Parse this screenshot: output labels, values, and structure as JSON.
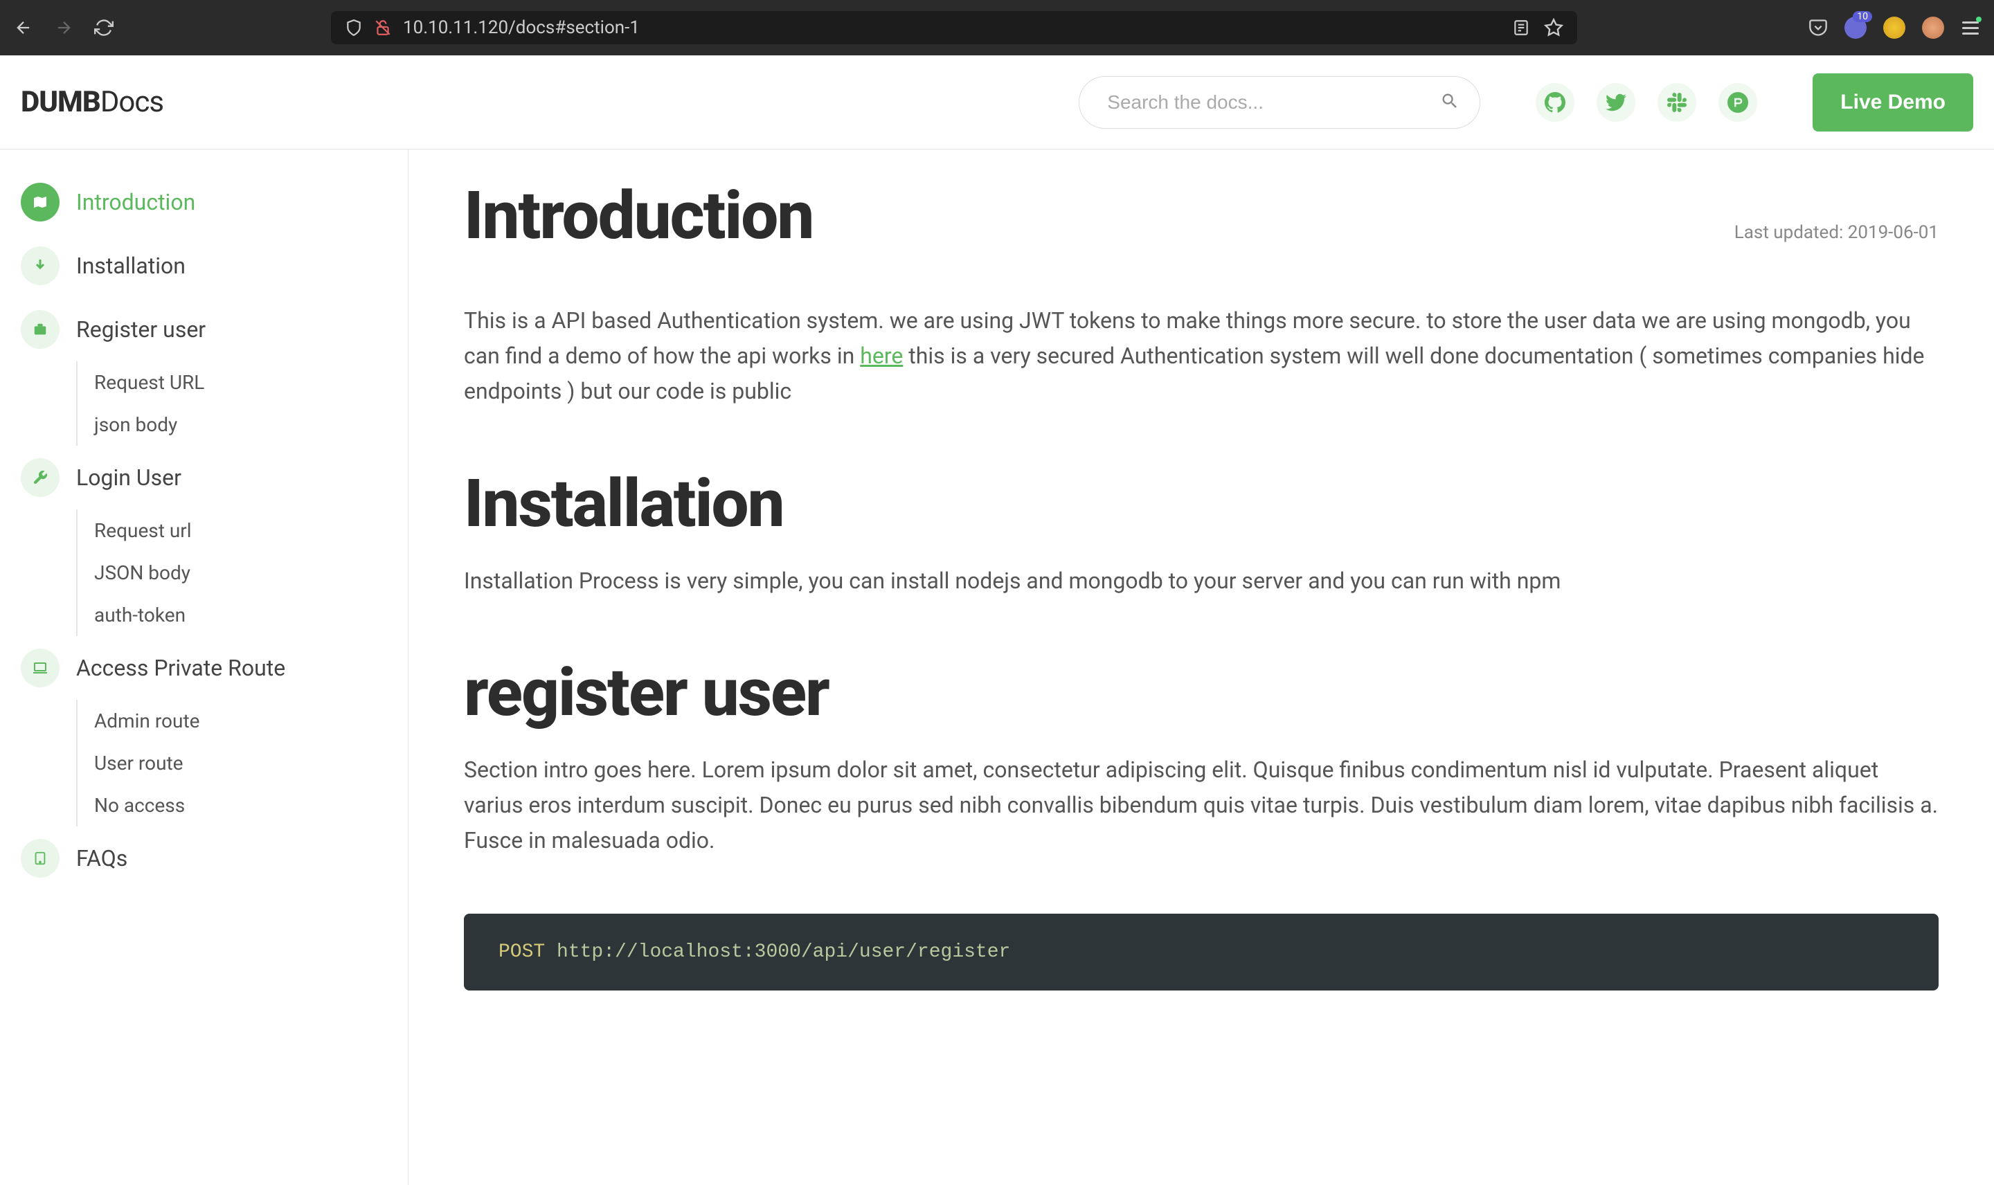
{
  "browser": {
    "url": "10.10.11.120/docs#section-1",
    "badge": "10"
  },
  "header": {
    "logo_bold": "DUMB",
    "logo_rest": "Docs",
    "search_placeholder": "Search the docs...",
    "live_demo": "Live Demo"
  },
  "sidebar": {
    "items": [
      {
        "label": "Introduction",
        "active": true,
        "icon": "map"
      },
      {
        "label": "Installation",
        "icon": "download"
      },
      {
        "label": "Register user",
        "icon": "briefcase",
        "children": [
          {
            "label": "Request URL"
          },
          {
            "label": "json body"
          }
        ]
      },
      {
        "label": "Login User",
        "icon": "tools",
        "children": [
          {
            "label": "Request url"
          },
          {
            "label": "JSON body"
          },
          {
            "label": "auth-token"
          }
        ]
      },
      {
        "label": "Access Private Route",
        "icon": "laptop",
        "children": [
          {
            "label": "Admin route"
          },
          {
            "label": "User route"
          },
          {
            "label": "No access"
          }
        ]
      },
      {
        "label": "FAQs",
        "icon": "tablet"
      }
    ]
  },
  "content": {
    "intro": {
      "title": "Introduction",
      "last_updated": "Last updated: 2019-06-01",
      "text_before": "This is a API based Authentication system. we are using JWT tokens to make things more secure. to store the user data we are using mongodb, you can find a demo of how the api works in ",
      "link": "here",
      "text_after": " this is a very secured Authentication system will well done documentation ( sometimes companies hide endpoints ) but our code is public"
    },
    "installation": {
      "title": "Installation",
      "text": "Installation Process is very simple, you can install nodejs and mongodb to your server and you can run with npm"
    },
    "register": {
      "title": "register user",
      "text": "Section intro goes here. Lorem ipsum dolor sit amet, consectetur adipiscing elit. Quisque finibus condimentum nisl id vulputate. Praesent aliquet varius eros interdum suscipit. Donec eu purus sed nibh convallis bibendum quis vitae turpis. Duis vestibulum diam lorem, vitae dapibus nibh facilisis a. Fusce in malesuada odio.",
      "code_method": "POST",
      "code_url": " http://localhost:3000/api/user/register"
    }
  }
}
